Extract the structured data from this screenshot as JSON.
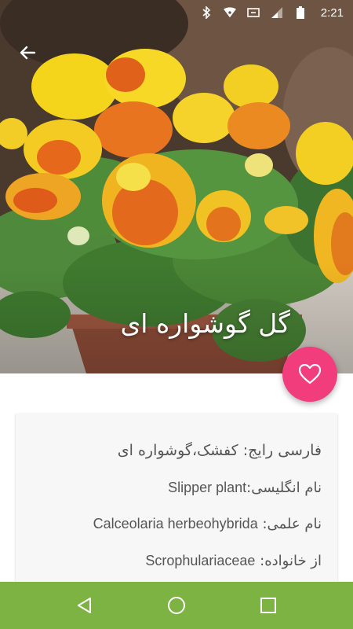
{
  "status_bar": {
    "time": "2:21",
    "icons": [
      "bluetooth-icon",
      "wifi-icon",
      "sync-icon",
      "signal-icon",
      "battery-icon"
    ]
  },
  "header": {
    "back_icon": "arrow-back-icon",
    "title": "گل گوشواره ای"
  },
  "fab": {
    "icon": "heart-outline-icon",
    "color": "#f23d7d"
  },
  "info": {
    "persian_common_name": "فارسی رایج: کفشک،گوشواره ای",
    "english_label": "نام انگلیسی:",
    "english_value": "Slipper plant",
    "scientific_label": "نام علمی:",
    "scientific_value": "Calceolaria herbeohybrida",
    "family_label": "از خانواده:",
    "family_value": "Scrophulariaceae"
  },
  "nav_bar": {
    "color": "#7cb342",
    "buttons": [
      "back-triangle-icon",
      "home-circle-icon",
      "recents-square-icon"
    ]
  }
}
